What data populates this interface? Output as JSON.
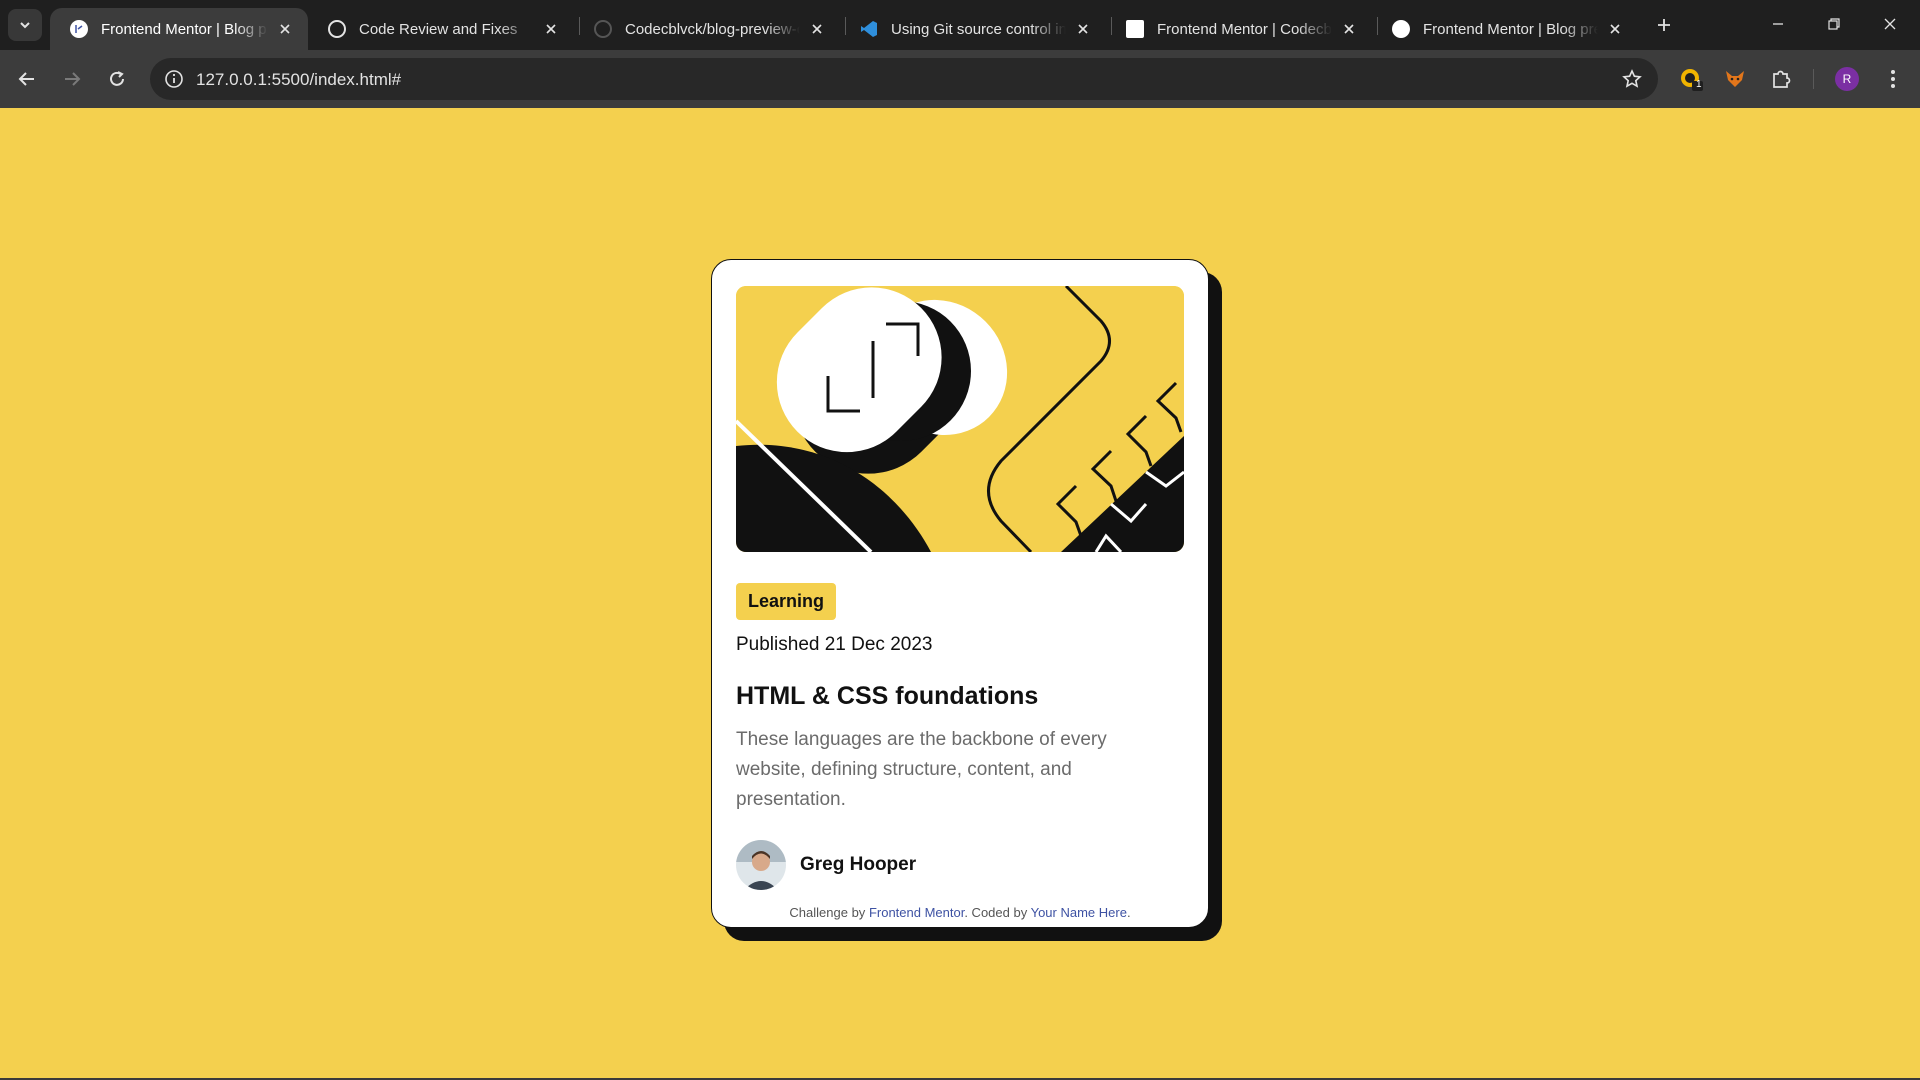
{
  "browser": {
    "tabs": [
      {
        "title": "Frontend Mentor | Blog preview card",
        "active": true,
        "favicon": "frontend-mentor-favicon"
      },
      {
        "title": "Code Review and Fixes",
        "active": false,
        "favicon": "chatgpt-favicon"
      },
      {
        "title": "Codecblvck/blog-preview-card",
        "active": false,
        "favicon": "github-favicon"
      },
      {
        "title": "Using Git source control in VS Code",
        "active": false,
        "favicon": "vscode-favicon"
      },
      {
        "title": "Frontend Mentor | Codecblvck",
        "active": false,
        "favicon": "frontend-mentor-favicon"
      },
      {
        "title": "Frontend Mentor | Blog preview card",
        "active": false,
        "favicon": "frontend-mentor-favicon"
      }
    ],
    "url": "127.0.0.1:5500/index.html#",
    "profile_initial": "R",
    "extension_badge_count": "1",
    "colors": {
      "tabstrip": "#1f1f1f",
      "toolbar": "#3c3c3c",
      "omnibox": "#282828",
      "profile": "#7b2fa3"
    }
  },
  "page": {
    "background": "#f4d04e",
    "card": {
      "category": "Learning",
      "published": "Published 21 Dec 2023",
      "title": "HTML & CSS foundations",
      "description": "These languages are the backbone of every website, defining structure, content, and presentation.",
      "author": "Greg Hooper",
      "attribution": {
        "prefix": "Challenge by",
        "link1": "Frontend Mentor",
        "middle": ". Coded by",
        "link2": "Your Name Here",
        "suffix": "."
      }
    }
  }
}
